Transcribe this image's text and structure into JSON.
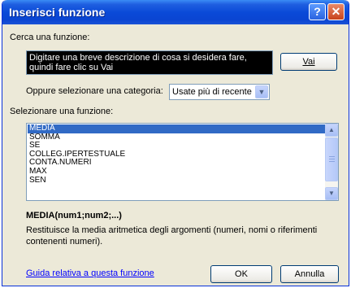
{
  "window": {
    "title": "Inserisci funzione",
    "help_button": "?",
    "close_button": "✕"
  },
  "search": {
    "label": "Cerca una funzione:",
    "value": "Digitare una breve descrizione di cosa si desidera fare, quindi fare clic su Vai",
    "go_button": "Vai"
  },
  "category": {
    "label": "Oppure selezionare una categoria:",
    "selected": "Usate più di recente"
  },
  "functions": {
    "label": "Selezionare una funzione:",
    "items": [
      "MEDIA",
      "SOMMA",
      "SE",
      "COLLEG.IPERTESTUALE",
      "CONTA.NUMERI",
      "MAX",
      "SEN"
    ],
    "selected_index": 0
  },
  "details": {
    "signature": "MEDIA(num1;num2;...)",
    "description": "Restituisce la media aritmetica degli argomenti (numeri, nomi o riferimenti contenenti numeri)."
  },
  "footer": {
    "help_link": "Guida relativa a questa funzione",
    "ok_button": "OK",
    "cancel_button": "Annulla"
  },
  "colors": {
    "titlebar": "#0a4ad8",
    "dialog_bg": "#ece9d8",
    "selection": "#316ac5",
    "link": "#0000ff"
  }
}
